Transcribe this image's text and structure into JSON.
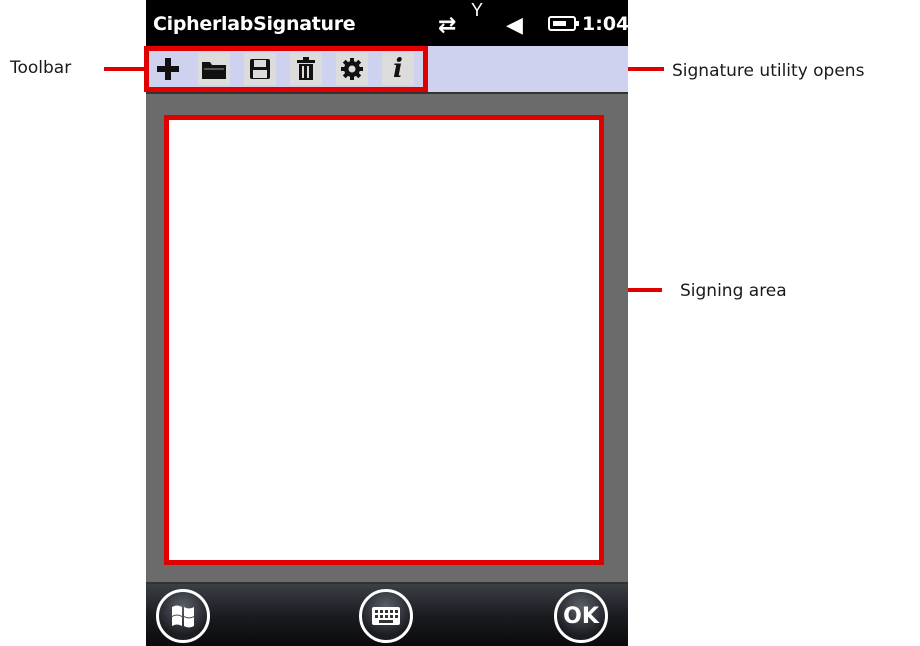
{
  "callouts": {
    "toolbar": "Toolbar",
    "utility": "Signature utility opens",
    "signing": "Signing area"
  },
  "statusbar": {
    "app_title": "CipherlabSignature",
    "time": "1:04",
    "icons": [
      "data-sync-icon",
      "signal-icon",
      "speaker-icon",
      "battery-icon"
    ]
  },
  "toolbar": {
    "buttons": [
      "new-icon",
      "open-folder-icon",
      "save-icon",
      "delete-icon",
      "settings-icon",
      "info-icon"
    ],
    "info_glyph": "i"
  },
  "softkeys": {
    "ok_label": "OK",
    "left_icon": "windows-start-icon",
    "center_icon": "keyboard-icon"
  },
  "colors": {
    "highlight": "#e10000",
    "toolbar_bg": "#cfd2ee",
    "frame_bg": "#6b6b6b"
  }
}
